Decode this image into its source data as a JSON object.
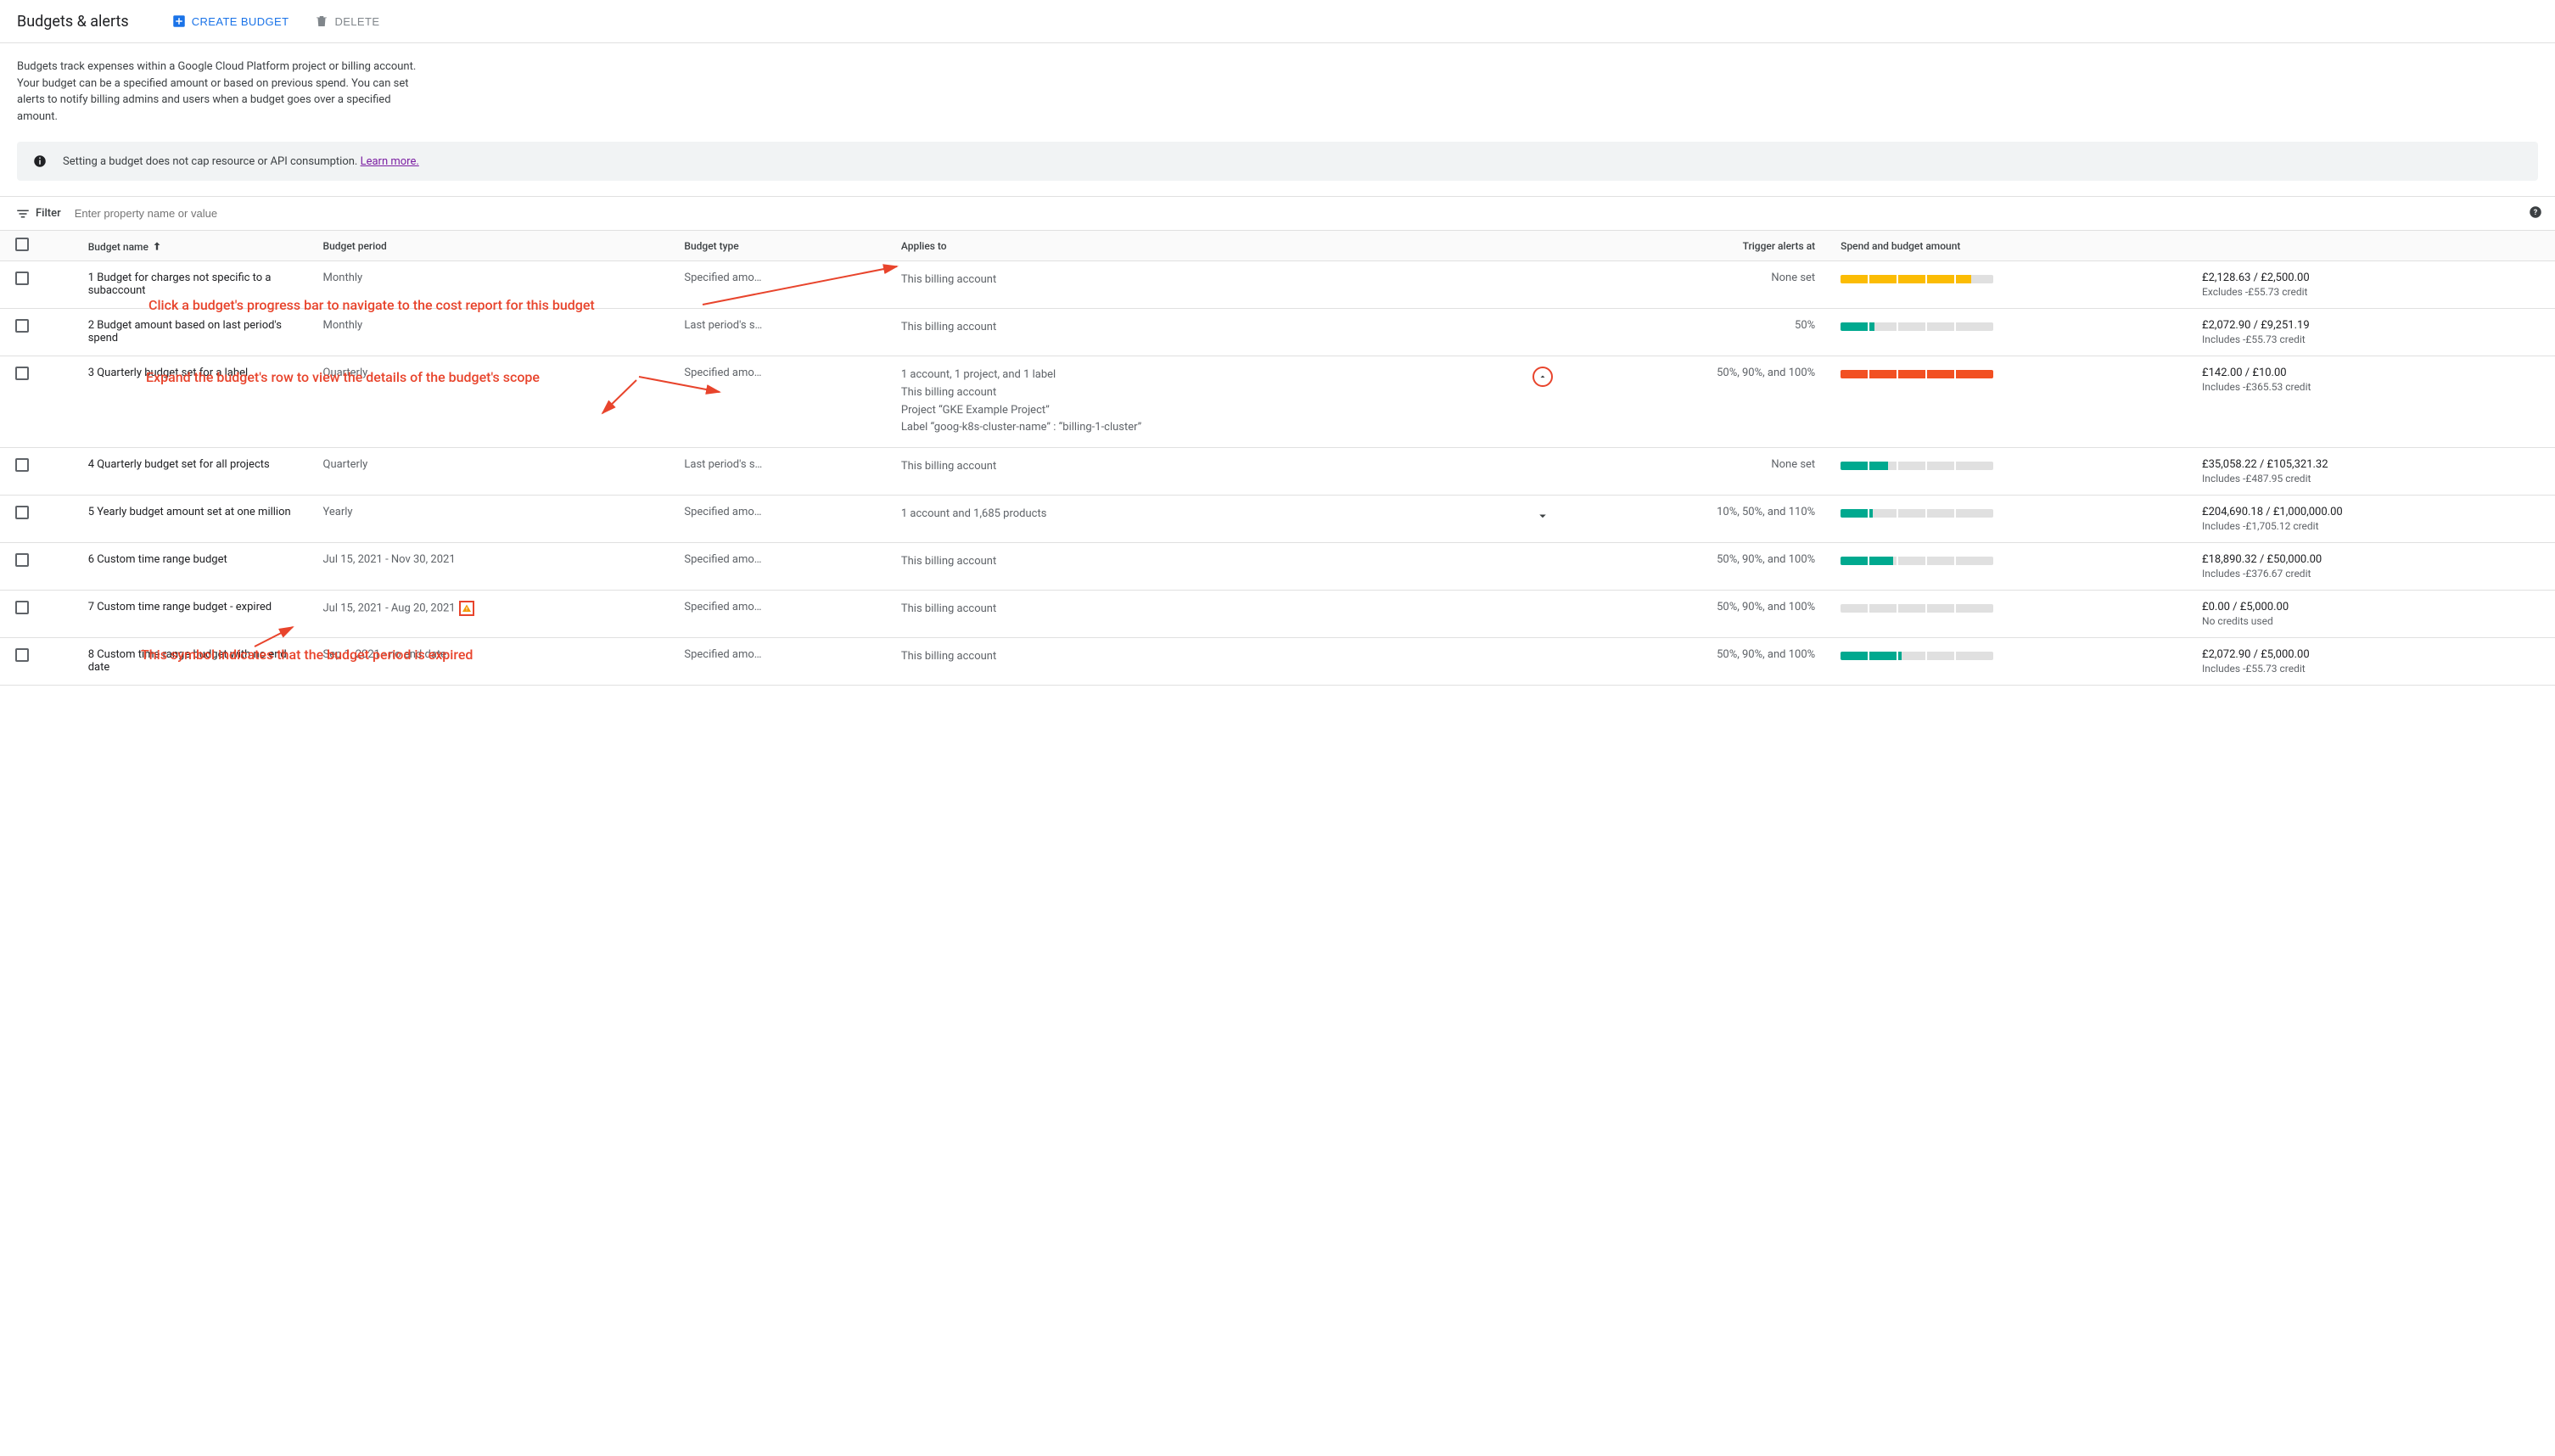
{
  "header": {
    "title": "Budgets & alerts",
    "create_label": "CREATE BUDGET",
    "delete_label": "DELETE"
  },
  "intro_text": "Budgets track expenses within a Google Cloud Platform project or billing account. Your budget can be a specified amount or based on previous spend. You can set alerts to notify billing admins and users when a budget goes over a specified amount.",
  "banner": {
    "text": "Setting a budget does not cap resource or API consumption. ",
    "link_text": "Learn more."
  },
  "filter": {
    "label": "Filter",
    "placeholder": "Enter property name or value"
  },
  "columns": {
    "name": "Budget name",
    "period": "Budget period",
    "type": "Budget type",
    "applies": "Applies to",
    "trigger": "Trigger alerts at",
    "spend": "Spend and budget amount"
  },
  "rows": [
    {
      "name": "1 Budget for charges not specific to a subaccount",
      "period": "Monthly",
      "type": "Specified amo…",
      "applies_summary": "This billing account",
      "applies_details": [],
      "expandable": false,
      "expanded": false,
      "warn": false,
      "trigger": "None set",
      "spend_main": "£2,128.63 / £2,500.00",
      "spend_sub": "Excludes -£55.73 credit",
      "progress": {
        "segments": [
          {
            "w": 32,
            "cls": "yellow-seg"
          },
          {
            "w": 2,
            "cls": "gap"
          },
          {
            "w": 32,
            "cls": "yellow-seg"
          },
          {
            "w": 2,
            "cls": "gap"
          },
          {
            "w": 32,
            "cls": "yellow-seg"
          },
          {
            "w": 2,
            "cls": "gap"
          },
          {
            "w": 32,
            "cls": "yellow-seg"
          },
          {
            "w": 2,
            "cls": "gap"
          },
          {
            "w": 18,
            "cls": "yellow-seg"
          },
          {
            "w": 26,
            "cls": "bg-seg"
          }
        ]
      }
    },
    {
      "name": "2 Budget amount based on last period's spend",
      "period": "Monthly",
      "type": "Last period's s…",
      "applies_summary": "This billing account",
      "applies_details": [],
      "expandable": false,
      "expanded": false,
      "warn": false,
      "trigger": "50%",
      "spend_main": "£2,072.90 / £9,251.19",
      "spend_sub": "Includes -£55.73 credit",
      "progress": {
        "segments": [
          {
            "w": 32,
            "cls": "teal-seg"
          },
          {
            "w": 2,
            "cls": "gap"
          },
          {
            "w": 6,
            "cls": "teal-seg"
          },
          {
            "w": 26,
            "cls": "bg-seg"
          },
          {
            "w": 2,
            "cls": "gap"
          },
          {
            "w": 32,
            "cls": "bg-seg"
          },
          {
            "w": 2,
            "cls": "gap"
          },
          {
            "w": 32,
            "cls": "bg-seg"
          },
          {
            "w": 2,
            "cls": "gap"
          },
          {
            "w": 44,
            "cls": "bg-seg"
          }
        ]
      }
    },
    {
      "name": "3 Quarterly budget set for a label",
      "period": "Quarterly",
      "type": "Specified amo…",
      "applies_summary": "1 account, 1 project, and 1 label",
      "applies_details": [
        "This billing account",
        "Project “GKE Example Project”",
        "Label “goog-k8s-cluster-name” : “billing-1-cluster”"
      ],
      "expandable": true,
      "expanded": true,
      "warn": false,
      "trigger": "50%, 90%, and 100%",
      "spend_main": "£142.00 / £10.00",
      "spend_sub": "Includes -£365.53 credit",
      "progress": {
        "segments": [
          {
            "w": 32,
            "cls": "red-seg"
          },
          {
            "w": 2,
            "cls": "gap"
          },
          {
            "w": 32,
            "cls": "red-seg"
          },
          {
            "w": 2,
            "cls": "gap"
          },
          {
            "w": 32,
            "cls": "red-seg"
          },
          {
            "w": 2,
            "cls": "gap"
          },
          {
            "w": 32,
            "cls": "red-seg"
          },
          {
            "w": 2,
            "cls": "gap"
          },
          {
            "w": 44,
            "cls": "red-seg"
          }
        ]
      }
    },
    {
      "name": "4 Quarterly budget set for all projects",
      "period": "Quarterly",
      "type": "Last period's s…",
      "applies_summary": "This billing account",
      "applies_details": [],
      "expandable": false,
      "expanded": false,
      "warn": false,
      "trigger": "None set",
      "spend_main": "£35,058.22 / £105,321.32",
      "spend_sub": "Includes -£487.95 credit",
      "progress": {
        "segments": [
          {
            "w": 32,
            "cls": "teal-seg"
          },
          {
            "w": 2,
            "cls": "gap"
          },
          {
            "w": 22,
            "cls": "teal-seg"
          },
          {
            "w": 10,
            "cls": "bg-seg"
          },
          {
            "w": 2,
            "cls": "gap"
          },
          {
            "w": 32,
            "cls": "bg-seg"
          },
          {
            "w": 2,
            "cls": "gap"
          },
          {
            "w": 32,
            "cls": "bg-seg"
          },
          {
            "w": 2,
            "cls": "gap"
          },
          {
            "w": 44,
            "cls": "bg-seg"
          }
        ]
      }
    },
    {
      "name": "5 Yearly budget amount set at one million",
      "period": "Yearly",
      "type": "Specified amo…",
      "applies_summary": "1 account and 1,685 products",
      "applies_details": [],
      "expandable": true,
      "expanded": false,
      "warn": false,
      "trigger": "10%, 50%, and 110%",
      "spend_main": "£204,690.18 / £1,000,000.00",
      "spend_sub": "Includes -£1,705.12 credit",
      "progress": {
        "segments": [
          {
            "w": 32,
            "cls": "teal-seg"
          },
          {
            "w": 2,
            "cls": "gap"
          },
          {
            "w": 4,
            "cls": "teal-seg"
          },
          {
            "w": 28,
            "cls": "bg-seg"
          },
          {
            "w": 2,
            "cls": "gap"
          },
          {
            "w": 32,
            "cls": "bg-seg"
          },
          {
            "w": 2,
            "cls": "gap"
          },
          {
            "w": 32,
            "cls": "bg-seg"
          },
          {
            "w": 2,
            "cls": "gap"
          },
          {
            "w": 44,
            "cls": "bg-seg"
          }
        ]
      }
    },
    {
      "name": "6 Custom time range budget",
      "period": "Jul 15, 2021 - Nov 30, 2021",
      "type": "Specified amo…",
      "applies_summary": "This billing account",
      "applies_details": [],
      "expandable": false,
      "expanded": false,
      "warn": false,
      "trigger": "50%, 90%, and 100%",
      "spend_main": "£18,890.32 / £50,000.00",
      "spend_sub": "Includes -£376.67 credit",
      "progress": {
        "segments": [
          {
            "w": 32,
            "cls": "teal-seg"
          },
          {
            "w": 2,
            "cls": "gap"
          },
          {
            "w": 28,
            "cls": "teal-seg"
          },
          {
            "w": 4,
            "cls": "bg-seg"
          },
          {
            "w": 2,
            "cls": "gap"
          },
          {
            "w": 32,
            "cls": "bg-seg"
          },
          {
            "w": 2,
            "cls": "gap"
          },
          {
            "w": 32,
            "cls": "bg-seg"
          },
          {
            "w": 2,
            "cls": "gap"
          },
          {
            "w": 44,
            "cls": "bg-seg"
          }
        ]
      }
    },
    {
      "name": "7 Custom time range budget - expired",
      "period": "Jul 15, 2021 - Aug 20, 2021",
      "type": "Specified amo…",
      "applies_summary": "This billing account",
      "applies_details": [],
      "expandable": false,
      "expanded": false,
      "warn": true,
      "trigger": "50%, 90%, and 100%",
      "spend_main": "£0.00 / £5,000.00",
      "spend_sub": "No credits used",
      "progress": {
        "segments": [
          {
            "w": 32,
            "cls": "bg-seg"
          },
          {
            "w": 2,
            "cls": "gap"
          },
          {
            "w": 32,
            "cls": "bg-seg"
          },
          {
            "w": 2,
            "cls": "gap"
          },
          {
            "w": 32,
            "cls": "bg-seg"
          },
          {
            "w": 2,
            "cls": "gap"
          },
          {
            "w": 32,
            "cls": "bg-seg"
          },
          {
            "w": 2,
            "cls": "gap"
          },
          {
            "w": 44,
            "cls": "bg-seg"
          }
        ]
      }
    },
    {
      "name": "8 Custom time range budget with no end date",
      "period": "Sep 1, 2021 - no end date",
      "type": "Specified amo…",
      "applies_summary": "This billing account",
      "applies_details": [],
      "expandable": false,
      "expanded": false,
      "warn": false,
      "trigger": "50%, 90%, and 100%",
      "spend_main": "£2,072.90 / £5,000.00",
      "spend_sub": "Includes -£55.73 credit",
      "progress": {
        "segments": [
          {
            "w": 32,
            "cls": "teal-seg"
          },
          {
            "w": 2,
            "cls": "gap"
          },
          {
            "w": 32,
            "cls": "teal-seg"
          },
          {
            "w": 2,
            "cls": "gap"
          },
          {
            "w": 4,
            "cls": "teal-seg"
          },
          {
            "w": 28,
            "cls": "bg-seg"
          },
          {
            "w": 2,
            "cls": "gap"
          },
          {
            "w": 32,
            "cls": "bg-seg"
          },
          {
            "w": 2,
            "cls": "gap"
          },
          {
            "w": 44,
            "cls": "bg-seg"
          }
        ]
      }
    }
  ],
  "annotations": {
    "a1": "Click a budget's progress bar to navigate to the cost report for this budget",
    "a2": "Expand the budget's row to view the details of the budget's scope",
    "a3": "This symbol indicates that the budget period is expired"
  }
}
